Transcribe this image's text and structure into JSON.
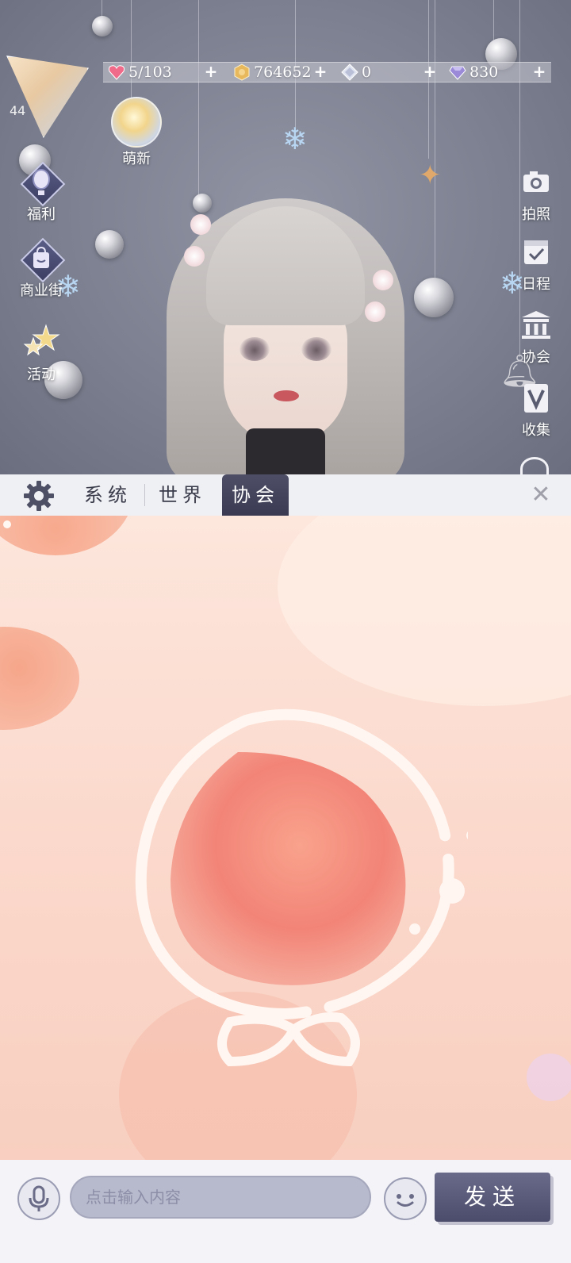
{
  "player": {
    "level": "44"
  },
  "resources": [
    {
      "name": "stamina",
      "icon": "heart-gem-icon",
      "value": "5/103",
      "color": "#f06a8a"
    },
    {
      "name": "gold",
      "icon": "gold-coin-icon",
      "value": "764652",
      "color": "#e8b85c"
    },
    {
      "name": "crystal",
      "icon": "crystal-icon",
      "value": "0",
      "color": "#e0e4f0"
    },
    {
      "name": "diamond",
      "icon": "diamond-icon",
      "value": "830",
      "color": "#9a8ad8"
    }
  ],
  "left_menu": {
    "newbie": "萌新",
    "welfare": "福利",
    "shop_street": "商业街",
    "events": "活动"
  },
  "right_menu": {
    "photo": "拍照",
    "schedule": "日程",
    "association": "协会",
    "collection": "收集"
  },
  "chat": {
    "tabs": [
      "系统",
      "世界",
      "协会"
    ],
    "active_tab": "协会",
    "input_placeholder": "点击输入内容",
    "send_label": "发送"
  }
}
